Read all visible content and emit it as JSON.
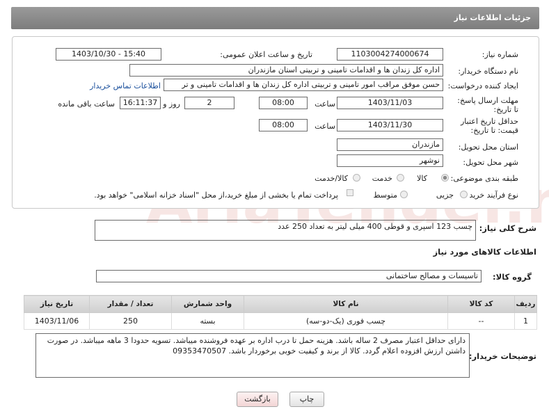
{
  "header": {
    "title": "جزئیات اطلاعات نیاز"
  },
  "form": {
    "need_number": {
      "label": "شماره نیاز:",
      "value": "1103004274000674"
    },
    "announce_datetime": {
      "label": "تاریخ و ساعت اعلان عمومی:",
      "value": "1403/10/30 - 15:40"
    },
    "buyer_org": {
      "label": "نام دستگاه خریدار:",
      "value": "اداره کل زندان ها و اقدامات تامینی و تربیتی استان مازندران"
    },
    "requester": {
      "label": "ایجاد کننده درخواست:",
      "value": "حسن موفق مراقب امور تامینی و تربیتی اداره کل زندان ها و اقدامات تامینی و تر",
      "contact_link": "اطلاعات تماس خریدار"
    },
    "response_deadline": {
      "label": "مهلت ارسال پاسخ: تا تاریخ:",
      "date": "1403/11/03",
      "time_label": "ساعت",
      "time": "08:00",
      "days": "2",
      "days_label": "روز و",
      "remaining": "16:11:37",
      "remaining_label": "ساعت باقی مانده"
    },
    "price_validity": {
      "label": "حداقل تاریخ اعتبار قیمت: تا تاریخ:",
      "date": "1403/11/30",
      "time_label": "ساعت",
      "time": "08:00"
    },
    "delivery_province": {
      "label": "استان محل تحویل:",
      "value": "مازندران"
    },
    "delivery_city": {
      "label": "شهر محل تحویل:",
      "value": "نوشهر"
    },
    "category": {
      "label": "طبقه بندی موضوعی:",
      "options": [
        "کالا",
        "خدمت",
        "کالا/خدمت"
      ],
      "selected": "کالا"
    },
    "purchase_process": {
      "label": "نوع فرآیند خرید :",
      "options": [
        "جزیی",
        "متوسط"
      ],
      "note": "پرداخت تمام یا بخشی از مبلغ خرید،از محل \"اسناد خزانه اسلامی\" خواهد بود."
    }
  },
  "description": {
    "label": "شرح کلی نیاز:",
    "value": "چسب 123 اسپری و قوطی 400 میلی لیتر به تعداد 250 عدد"
  },
  "goods_info": {
    "title": "اطلاعات کالاهای مورد نیاز"
  },
  "goods_group": {
    "label": "گروه کالا:",
    "value": "تاسیسات و مصالح ساختمانی"
  },
  "table": {
    "headers": [
      "ردیف",
      "کد کالا",
      "نام کالا",
      "واحد شمارش",
      "تعداد / مقدار",
      "تاریخ نیاز"
    ],
    "rows": [
      [
        "1",
        "--",
        "چسب فوری (یک-دو-سه)",
        "بسته",
        "250",
        "1403/11/06"
      ]
    ]
  },
  "buyer_notes": {
    "label": "توضیحات خریدار:",
    "value": "دارای حداقل اعتبار مصرف 2 ساله باشد. هزینه حمل تا درب اداره بر عهده فروشنده میباشد. تسویه حدودا 3 ماهه میباشد. در صورت داشتن ارزش افزوده اعلام گردد. کالا از برند و کیفیت خوبی برخوردار باشد. 09353470507"
  },
  "buttons": {
    "print": "چاپ",
    "back": "بازگشت"
  },
  "watermark": {
    "text": "AriaTender.net"
  },
  "colors": {
    "header_bg": "#8a8a8a",
    "link": "#1a4f9c",
    "back_button_bg": "#fbe6e6"
  }
}
